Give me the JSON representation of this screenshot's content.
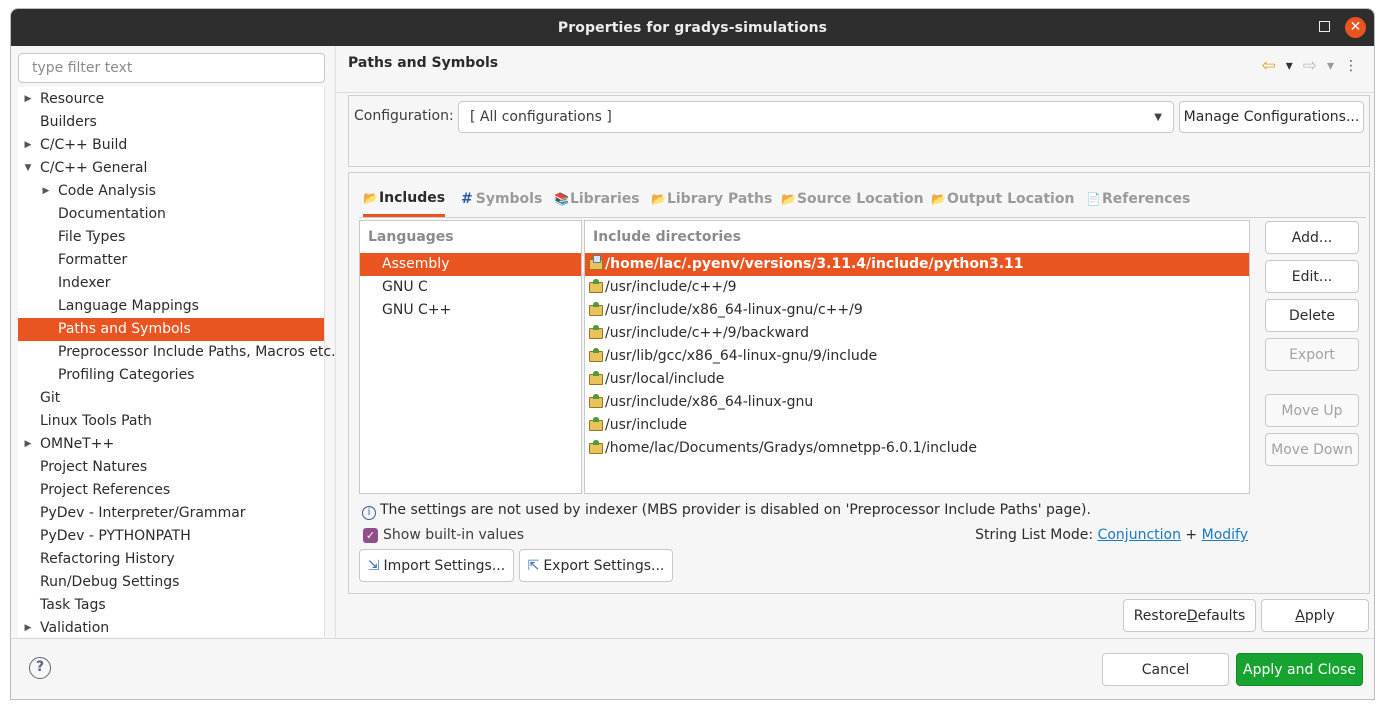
{
  "window": {
    "title": "Properties for gradys-simulations",
    "maximize_icon": "maximize-icon",
    "close_icon": "close-icon"
  },
  "filter": {
    "placeholder": "type filter text",
    "value": ""
  },
  "tree": [
    {
      "label": "Resource",
      "level": 0,
      "expander": "collapsed"
    },
    {
      "label": "Builders",
      "level": 0,
      "expander": "none"
    },
    {
      "label": "C/C++ Build",
      "level": 0,
      "expander": "collapsed"
    },
    {
      "label": "C/C++ General",
      "level": 0,
      "expander": "expanded"
    },
    {
      "label": "Code Analysis",
      "level": 1,
      "expander": "collapsed"
    },
    {
      "label": "Documentation",
      "level": 1,
      "expander": "none"
    },
    {
      "label": "File Types",
      "level": 1,
      "expander": "none"
    },
    {
      "label": "Formatter",
      "level": 1,
      "expander": "none"
    },
    {
      "label": "Indexer",
      "level": 1,
      "expander": "none"
    },
    {
      "label": "Language Mappings",
      "level": 1,
      "expander": "none"
    },
    {
      "label": "Paths and Symbols",
      "level": 1,
      "expander": "none",
      "selected": true
    },
    {
      "label": "Preprocessor Include Paths, Macros etc.",
      "level": 1,
      "expander": "none"
    },
    {
      "label": "Profiling Categories",
      "level": 1,
      "expander": "none"
    },
    {
      "label": "Git",
      "level": 0,
      "expander": "none"
    },
    {
      "label": "Linux Tools Path",
      "level": 0,
      "expander": "none"
    },
    {
      "label": "OMNeT++",
      "level": 0,
      "expander": "collapsed"
    },
    {
      "label": "Project Natures",
      "level": 0,
      "expander": "none"
    },
    {
      "label": "Project References",
      "level": 0,
      "expander": "none"
    },
    {
      "label": "PyDev - Interpreter/Grammar",
      "level": 0,
      "expander": "none"
    },
    {
      "label": "PyDev - PYTHONPATH",
      "level": 0,
      "expander": "none"
    },
    {
      "label": "Refactoring History",
      "level": 0,
      "expander": "none"
    },
    {
      "label": "Run/Debug Settings",
      "level": 0,
      "expander": "none"
    },
    {
      "label": "Task Tags",
      "level": 0,
      "expander": "none"
    },
    {
      "label": "Validation",
      "level": 0,
      "expander": "collapsed"
    }
  ],
  "page": {
    "title": "Paths and Symbols",
    "nav": {
      "back": "⇦",
      "back_menu": "▾",
      "forward": "⇨",
      "forward_menu": "▾",
      "more": "⋮"
    }
  },
  "configuration": {
    "label": "Configuration:",
    "value": "[ All configurations ]",
    "dropdown_arrow": "▼",
    "manage_button": "Manage Configurations..."
  },
  "tabs": [
    {
      "label": "Includes",
      "icon": "includes-icon",
      "glyph": "📂",
      "active": true
    },
    {
      "label": "Symbols",
      "icon": "hash-icon",
      "glyph": "#"
    },
    {
      "label": "Libraries",
      "icon": "libraries-icon",
      "glyph": "📚"
    },
    {
      "label": "Library Paths",
      "icon": "library-paths-icon",
      "glyph": "📂"
    },
    {
      "label": "Source Location",
      "icon": "source-location-icon",
      "glyph": "📂"
    },
    {
      "label": "Output Location",
      "icon": "output-location-icon",
      "glyph": "📂"
    },
    {
      "label": "References",
      "icon": "references-icon",
      "glyph": "📄"
    }
  ],
  "languages": {
    "header": "Languages",
    "items": [
      {
        "label": "Assembly",
        "selected": true
      },
      {
        "label": "GNU C"
      },
      {
        "label": "GNU C++"
      }
    ]
  },
  "include_dirs": {
    "header": "Include directories",
    "items": [
      {
        "path": "/home/lac/.pyenv/versions/3.11.4/include/python3.11",
        "kind": "user",
        "selected": true
      },
      {
        "path": "/usr/include/c++/9",
        "kind": "builtin"
      },
      {
        "path": "/usr/include/x86_64-linux-gnu/c++/9",
        "kind": "builtin"
      },
      {
        "path": "/usr/include/c++/9/backward",
        "kind": "builtin"
      },
      {
        "path": "/usr/lib/gcc/x86_64-linux-gnu/9/include",
        "kind": "builtin"
      },
      {
        "path": "/usr/local/include",
        "kind": "builtin"
      },
      {
        "path": "/usr/include/x86_64-linux-gnu",
        "kind": "builtin"
      },
      {
        "path": "/usr/include",
        "kind": "builtin"
      },
      {
        "path": "/home/lac/Documents/Gradys/omnetpp-6.0.1/include",
        "kind": "builtin"
      }
    ]
  },
  "side_buttons": [
    {
      "label": "Add...",
      "enabled": true
    },
    {
      "label": "Edit...",
      "enabled": true
    },
    {
      "label": "Delete",
      "enabled": true
    },
    {
      "label": "Export",
      "enabled": false
    },
    {
      "label": "Move Up",
      "enabled": false
    },
    {
      "label": "Move Down",
      "enabled": false
    }
  ],
  "info_message": "The settings are not used by indexer (MBS provider is disabled on 'Preprocessor Include Paths' page).",
  "show_builtin": {
    "label": "Show built-in values",
    "checked": true
  },
  "string_list_mode": {
    "label": "String List Mode:",
    "link1": "Conjunction",
    "separator": "+",
    "link2": "Modify"
  },
  "import_button": "Import Settings...",
  "export_button": "Export Settings...",
  "restore_defaults": {
    "prefix": "Restore ",
    "mnemonic": "D",
    "suffix": "efaults"
  },
  "apply": {
    "mnemonic": "A",
    "suffix": "pply"
  },
  "cancel_button": "Cancel",
  "apply_close_button": "Apply and Close",
  "colors": {
    "accent": "#e95420",
    "primary_button": "#17a32f",
    "link": "#1a79c4",
    "checkbox": "#924d8b"
  }
}
